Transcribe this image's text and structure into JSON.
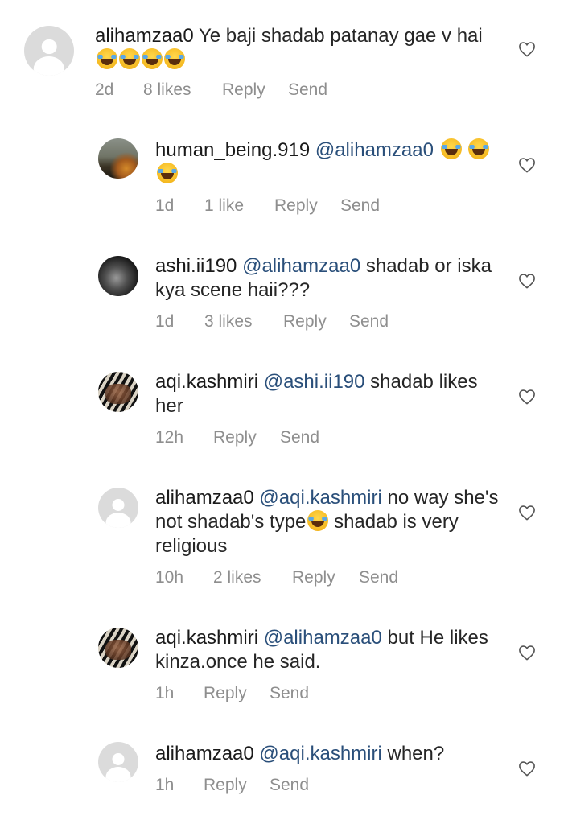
{
  "comments": [
    {
      "username": "alihamzaa0",
      "mention": "",
      "text": "Ye baji shadab patanay gae v hai",
      "emojis": [
        "😂",
        "😂",
        "😂",
        "😂"
      ],
      "time": "2d",
      "likes": "8 likes",
      "reply": "Reply",
      "send": "Send",
      "avatar": "default-avatar"
    },
    {
      "username": "human_being.919",
      "mention": "@alihamzaa0",
      "text": "",
      "emojis": [
        "😂",
        "😂",
        "😂"
      ],
      "time": "1d",
      "likes": "1 like",
      "reply": "Reply",
      "send": "Send",
      "avatar": "sunset-photo-avatar"
    },
    {
      "username": "ashi.ii190",
      "mention": "@alihamzaa0",
      "text": "shadab or iska kya scene haii???",
      "emojis": [],
      "time": "1d",
      "likes": "3 likes",
      "reply": "Reply",
      "send": "Send",
      "avatar": "dark-photo-avatar"
    },
    {
      "username": "aqi.kashmiri",
      "mention": "@ashi.ii190",
      "text": "shadab likes her",
      "emojis": [],
      "time": "12h",
      "likes": "",
      "reply": "Reply",
      "send": "Send",
      "avatar": "zebra-photo-avatar"
    },
    {
      "username": "alihamzaa0",
      "mention": "@aqi.kashmiri",
      "text": "no way she's not shadab's type",
      "text2": "shadab is very religious",
      "emojis": [
        "😂"
      ],
      "time": "10h",
      "likes": "2 likes",
      "reply": "Reply",
      "send": "Send",
      "avatar": "default-avatar"
    },
    {
      "username": "aqi.kashmiri",
      "mention": "@alihamzaa0",
      "text": " but He likes kinza.once he said.",
      "emojis": [],
      "time": "1h",
      "likes": "",
      "reply": "Reply",
      "send": "Send",
      "avatar": "zebra-photo-avatar"
    },
    {
      "username": "alihamzaa0",
      "mention": "@aqi.kashmiri",
      "text": "when?",
      "emojis": [],
      "time": "1h",
      "likes": "",
      "reply": "Reply",
      "send": "Send",
      "avatar": "default-avatar"
    }
  ],
  "icons": {
    "heart": "heart-outline-icon",
    "emoji": "face-with-tears-of-joy-emoji"
  },
  "colors": {
    "mention": "#2a4f7a",
    "meta": "#8e8e8e",
    "text": "#262626"
  }
}
